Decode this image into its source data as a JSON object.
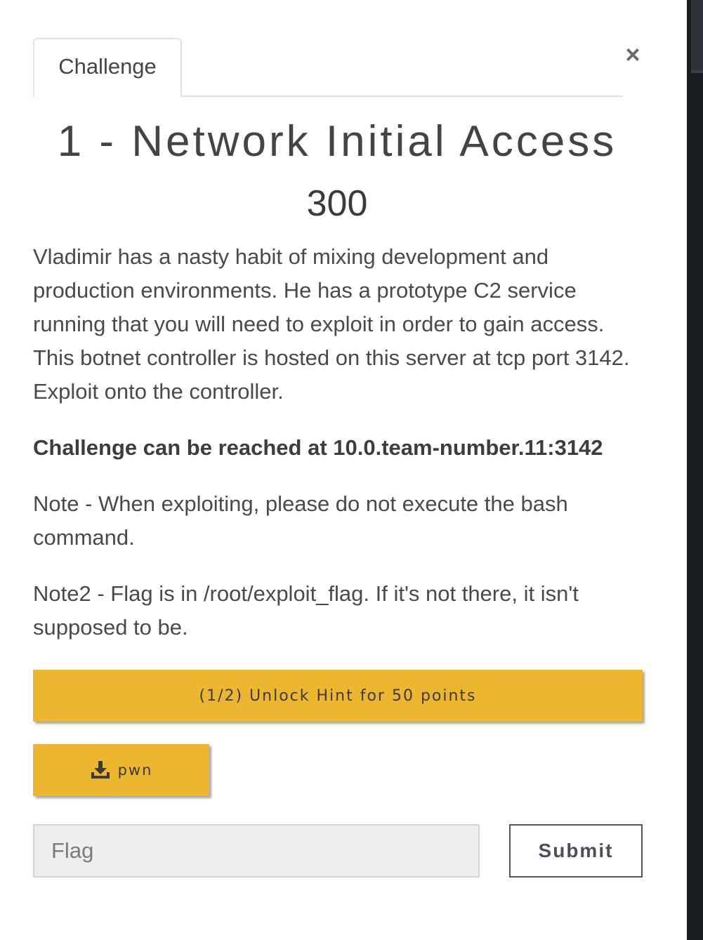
{
  "tabs": [
    {
      "label": "Challenge"
    }
  ],
  "close_glyph": "×",
  "challenge": {
    "title": "1 - Network Initial Access",
    "points": "300",
    "description": [
      "Vladimir has a nasty habit of mixing development and production environments. He has a prototype C2 service running that you will need to exploit in order to gain access. This botnet controller is hosted on this server at tcp port 3142. Exploit onto the controller.",
      "Challenge can be reached at 10.0.team-number.11:3142",
      "Note - When exploiting, please do not execute the bash command.",
      "Note2 - Flag is in /root/exploit_flag. If it's not there, it isn't supposed to be."
    ]
  },
  "hint_button": {
    "label": "(1/2) Unlock Hint for 50 points"
  },
  "file_button": {
    "label": "pwn",
    "icon": "download-icon"
  },
  "flag_input": {
    "placeholder": "Flag",
    "value": ""
  },
  "submit_button": {
    "label": "Submit"
  },
  "colors": {
    "accent": "#ecb72f",
    "text": "#4a4a4a",
    "input_bg": "#eeeeee"
  }
}
